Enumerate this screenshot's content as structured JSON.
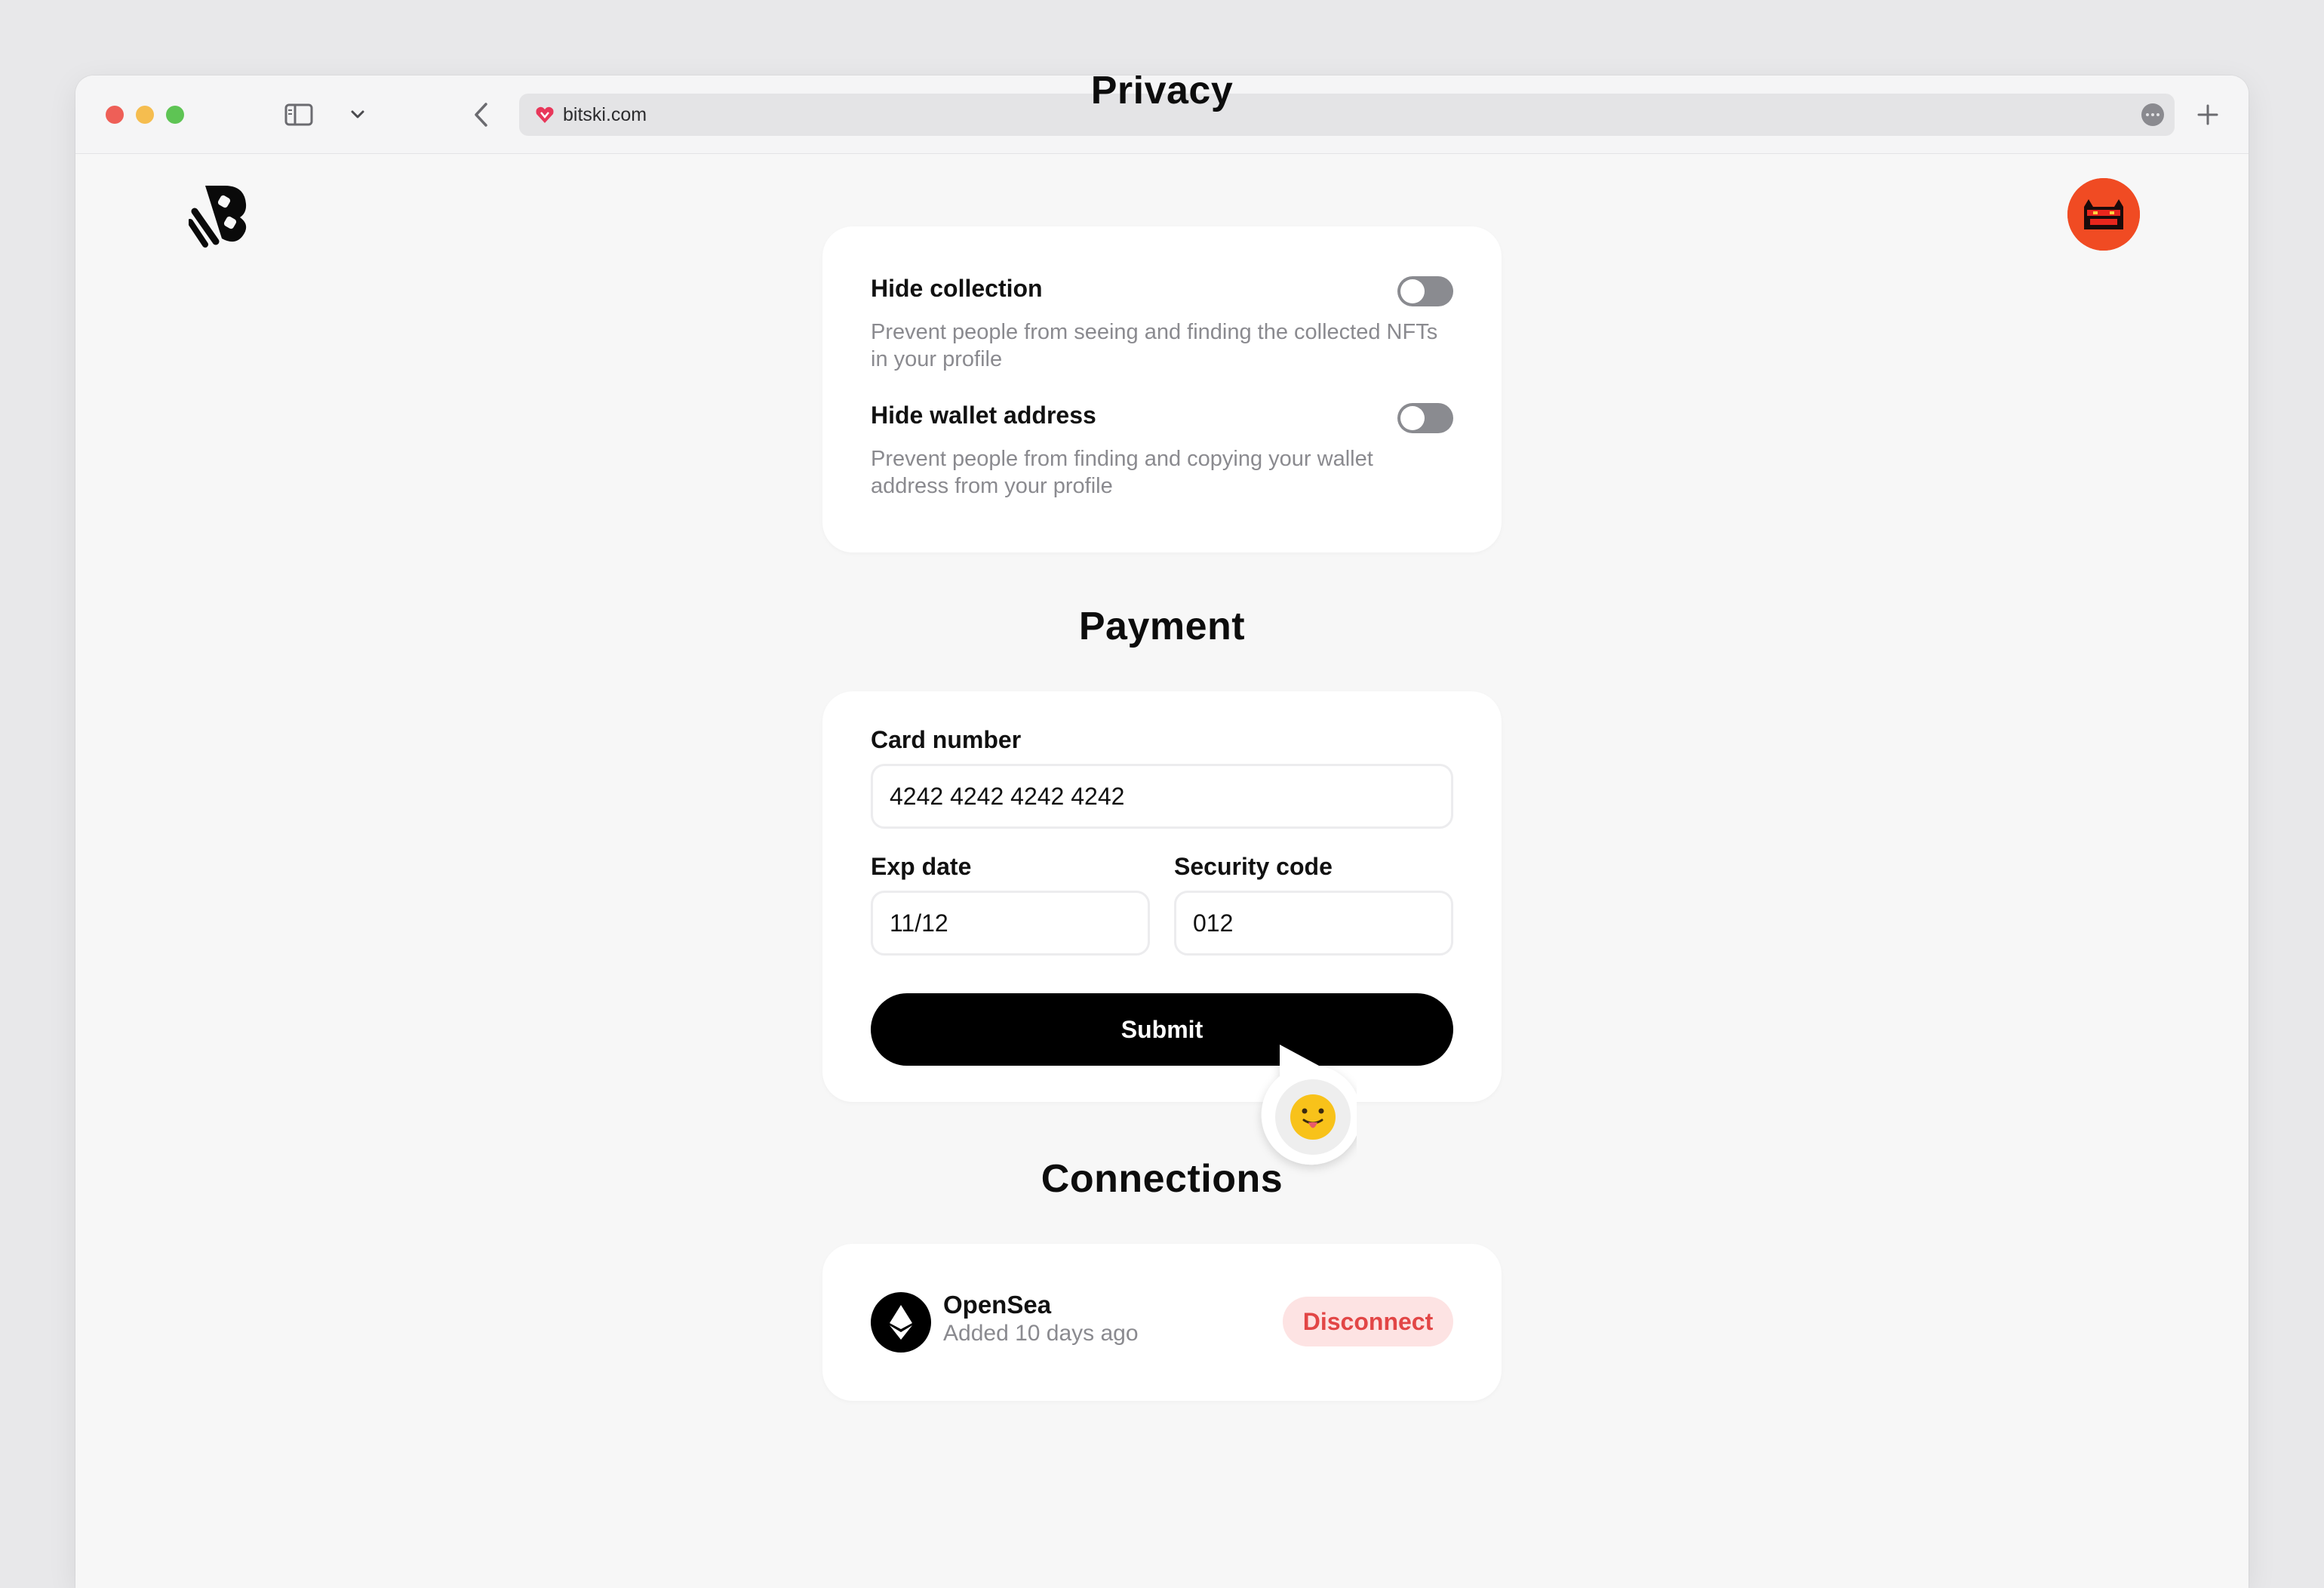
{
  "browser": {
    "url": "bitski.com",
    "accent": "#e8375a"
  },
  "sections": {
    "privacy_title": "Privacy",
    "payment_title": "Payment",
    "connections_title": "Connections"
  },
  "privacy": {
    "items": [
      {
        "title": "Hide collection",
        "description": "Prevent people from seeing and finding the collected NFTs in your profile",
        "enabled": false
      },
      {
        "title": "Hide wallet address",
        "description": "Prevent people from finding and copying your wallet address from your profile",
        "enabled": false
      }
    ]
  },
  "payment": {
    "card_number_label": "Card number",
    "card_number_value": "4242 4242 4242 4242",
    "exp_label": "Exp date",
    "exp_value": "11/12",
    "security_label": "Security code",
    "security_value": "012",
    "submit_label": "Submit"
  },
  "connections": {
    "items": [
      {
        "name": "OpenSea",
        "subtitle": "Added 10 days ago",
        "action": "Disconnect",
        "icon": "ethereum-icon"
      }
    ]
  },
  "colors": {
    "avatar_bg": "#f04b23",
    "disconnect_bg": "#fde3e3",
    "disconnect_text": "#e24646",
    "toggle_off": "#8a8b90"
  }
}
